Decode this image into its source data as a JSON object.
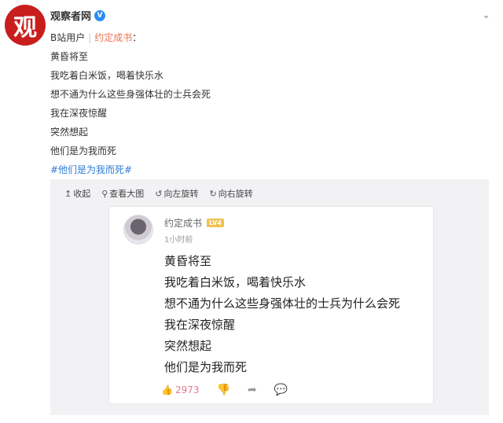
{
  "account": {
    "avatar_glyph": "观",
    "name": "观察者网",
    "verified_mark": "V"
  },
  "post": {
    "source_prefix": "B站用户",
    "source_sep": "|",
    "source_author": "约定成书",
    "source_suffix": "：",
    "lines": [
      "黄昏将至",
      "我吃着白米饭，喝着快乐水",
      "想不通为什么这些身强体壮的士兵会死",
      "我在深夜惊醒",
      "突然想起",
      "他们是为我而死"
    ],
    "hashtag": "#他们是为我而死#"
  },
  "media_toolbar": {
    "collapse": "收起",
    "view_large": "查看大图",
    "rotate_left": "向左旋转",
    "rotate_right": "向右旋转"
  },
  "screenshot": {
    "author": "约定成书",
    "level_badge": "LV4",
    "time": "1小时前",
    "lines": [
      "黄昏将至",
      "我吃着白米饭，喝着快乐水",
      "想不通为什么这些身强体壮的士兵为什么会死",
      "我在深夜惊醒",
      "突然想起",
      "他们是为我而死"
    ],
    "like_count": "2973"
  },
  "icons": {
    "collapse": "arrow-up-icon",
    "view_large": "magnifier-icon",
    "rotate_left": "rotate-left-icon",
    "rotate_right": "rotate-right-icon",
    "like": "thumbs-up-icon",
    "dislike": "thumbs-down-icon",
    "share": "share-icon",
    "comment": "comment-icon"
  },
  "colors": {
    "avatar_bg": "#c81e1e",
    "verified": "#2d8cf0",
    "source_author": "#eb7350",
    "hashtag": "#2d7cd6",
    "like": "#e07b8c"
  }
}
